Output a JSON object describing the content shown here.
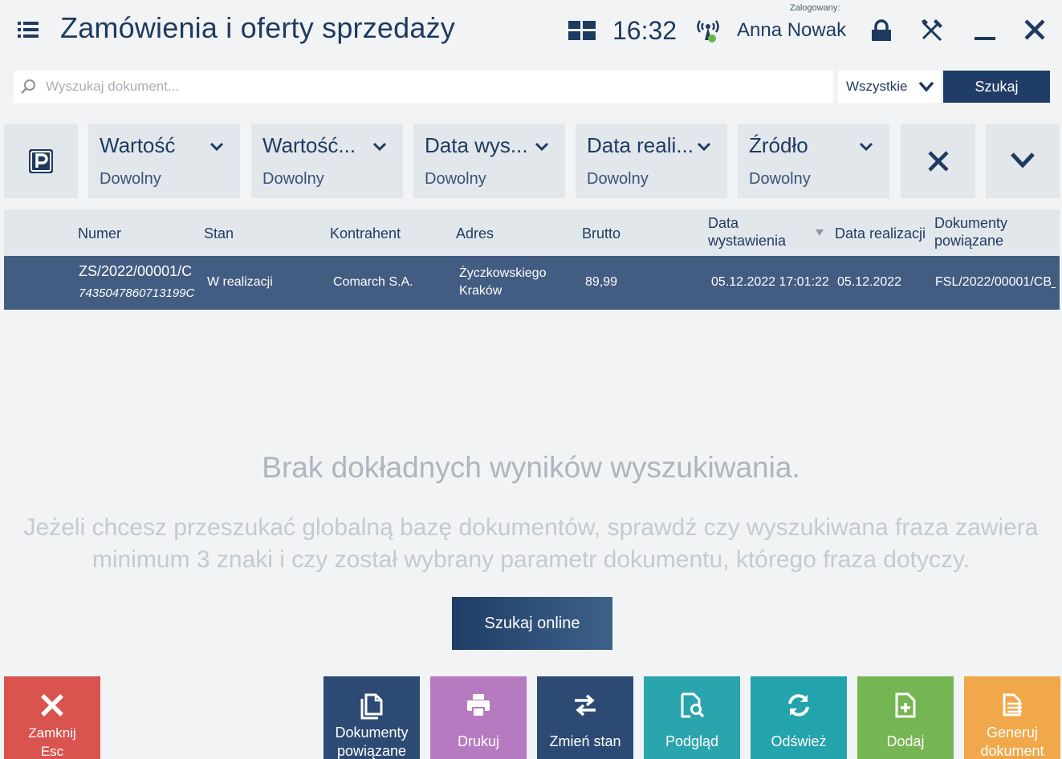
{
  "header": {
    "title": "Zamówienia i oferty sprzedaży",
    "clock": "16:32",
    "logged_label": "Zalogowany:",
    "user_name": "Anna Nowak"
  },
  "search": {
    "placeholder": "Wyszukaj dokument...",
    "scope_value": "Wszystkie",
    "button_label": "Szukaj"
  },
  "filters": [
    {
      "title": "Wartość",
      "value": "Dowolny"
    },
    {
      "title": "Wartość...",
      "value": "Dowolny"
    },
    {
      "title": "Data wys...",
      "value": "Dowolny"
    },
    {
      "title": "Data reali...",
      "value": "Dowolny"
    },
    {
      "title": "Źródło",
      "value": "Dowolny"
    }
  ],
  "table": {
    "columns": {
      "numer": "Numer",
      "stan": "Stan",
      "kontrahent": "Kontrahent",
      "adres": "Adres",
      "brutto": "Brutto",
      "data_wyst_1": "Data",
      "data_wyst_2": "wystawienia",
      "data_real": "Data realizacji",
      "dok_1": "Dokumenty",
      "dok_2": "powiązane"
    },
    "rows": [
      {
        "numer": "ZS/2022/00001/C",
        "kod": "7435047860713199C",
        "stan": "W realizacji",
        "kontrahent": "Comarch S.A.",
        "adres_1": "Życzkowskiego",
        "adres_2": "Kraków",
        "brutto": "89,99",
        "data_wyst": "05.12.2022 17:01:22",
        "data_real": "05.12.2022",
        "dokumenty": "FSL/2022/00001/CB_"
      }
    ]
  },
  "empty": {
    "title": "Brak dokładnych wyników wyszukiwania.",
    "line1": "Jeżeli chcesz przeszukać globalną bazę dokumentów, sprawdź czy wyszukiwana fraza zawiera",
    "line2": "minimum 3 znaki i czy został wybrany parametr dokumentu, którego fraza dotyczy.",
    "online_button": "Szukaj online"
  },
  "bottom": {
    "close_1": "Zamknij",
    "close_2": "Esc",
    "docs_1": "Dokumenty",
    "docs_2": "powiązane",
    "print": "Drukuj",
    "change_state": "Zmień stan",
    "preview": "Podgląd",
    "refresh": "Odśwież",
    "add": "Dodaj",
    "generate_1": "Generuj",
    "generate_2": "dokument"
  },
  "colors": {
    "navy": "#1f3d66",
    "selected_row": "#435c82",
    "close_red": "#d9534f",
    "docs_navy": "#2c4a73",
    "print_purple": "#b57abf",
    "change_navy": "#2c4a73",
    "preview_teal": "#2ba5ad",
    "refresh_teal": "#23a3ab",
    "add_green": "#76b553",
    "generate_orange": "#f0a84a"
  }
}
